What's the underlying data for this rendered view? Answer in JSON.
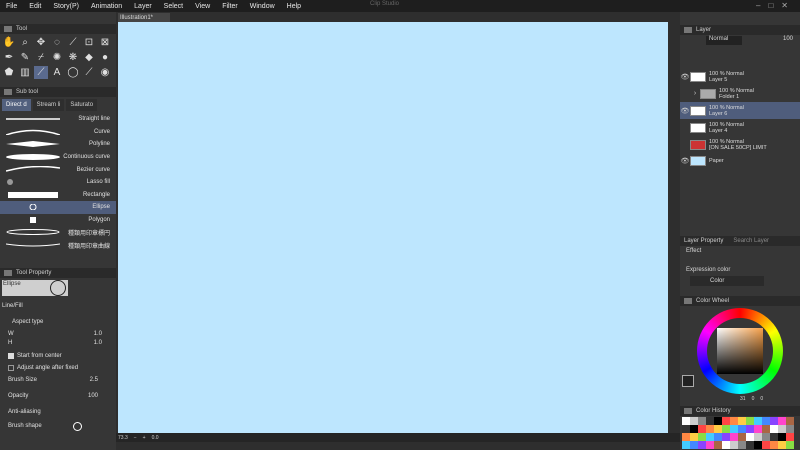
{
  "menu": [
    "File",
    "Edit",
    "Story(P)",
    "Animation",
    "Layer",
    "Select",
    "View",
    "Filter",
    "Window",
    "Help"
  ],
  "window_title": "Clip Studio",
  "tool_panel": {
    "title": "Tool"
  },
  "sub_tool_panel": {
    "title": "Sub tool",
    "tabs": [
      "Direct d",
      "Stream li",
      "Saturato"
    ]
  },
  "brushes": [
    "Straight line",
    "Curve",
    "Polyline",
    "Continuous curve",
    "Bezier curve",
    "Lasso fill",
    "Rectangle",
    "Ellipse",
    "Polygon",
    "種類用印章標円",
    "種類用印章曲線"
  ],
  "selected_brush_index": 7,
  "tool_property": {
    "title": "Tool Property",
    "preview_label": "Ellipse",
    "line_fill": "Line/Fill",
    "aspect_type": "Aspect type",
    "w_label": "W",
    "w_value": "1.0",
    "h_label": "H",
    "h_value": "1.0",
    "start_from_center": "Start from center",
    "adjust_angle": "Adjust angle after fixed",
    "brush_size_label": "Brush Size",
    "brush_size_value": "2.5",
    "opacity_label": "Opacity",
    "opacity_value": "100",
    "anti_aliasing": "Anti-aliasing",
    "brush_shape": "Brush shape"
  },
  "document_tab": "Illustration1*",
  "status": {
    "zoom": "73.3",
    "angle": "0.0"
  },
  "layer_panel": {
    "title": "Layer",
    "blend_mode": "Normal",
    "opacity": "100",
    "layers": [
      {
        "opacity": "100 % Normal",
        "name": "Layer 5"
      },
      {
        "opacity": "100 % Normal",
        "name": "Folder 1"
      },
      {
        "opacity": "100 % Normal",
        "name": "Layer 6"
      },
      {
        "opacity": "100 % Normal",
        "name": "Layer 4"
      },
      {
        "opacity": "100 % Normal",
        "name": "[ON SALE 50CP] LIMIT"
      },
      {
        "opacity": "",
        "name": "Paper"
      }
    ]
  },
  "layer_property": {
    "tab1": "Layer Property",
    "tab2": "Search Layer",
    "effect": "Effect",
    "expression_color": "Expression color",
    "color_value": "Color"
  },
  "color_wheel": {
    "title": "Color Wheel",
    "values": [
      "31",
      "0",
      "0"
    ]
  },
  "color_history": {
    "title": "Color History"
  },
  "colors": {
    "canvas": "#bde6fe",
    "accent": "#4f5d7c",
    "bg": "#363636"
  }
}
